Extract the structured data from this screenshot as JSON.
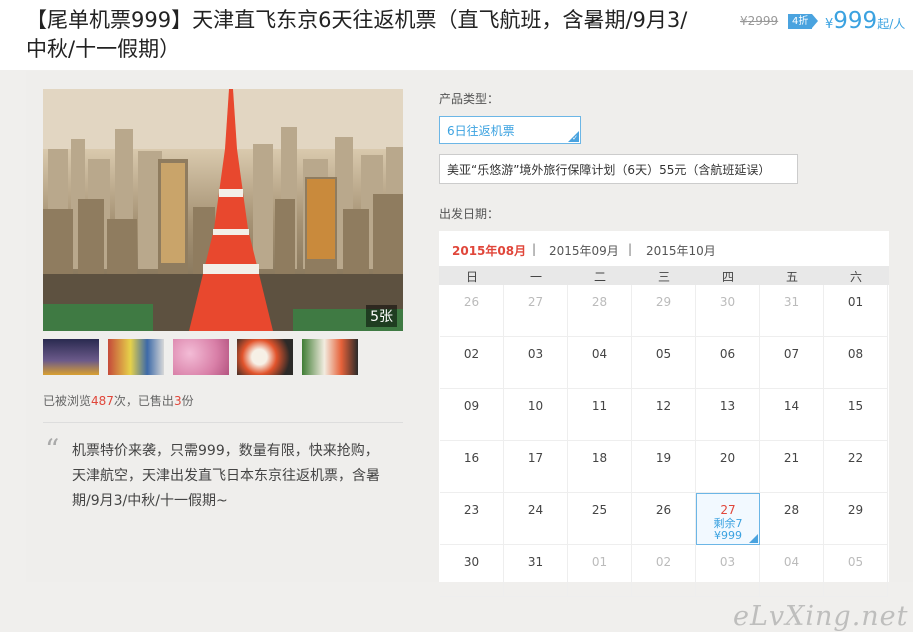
{
  "header": {
    "title": "【尾单机票999】天津直飞东京6天往返机票（直飞航班，含暑期/9月3/中秋/十一假期）",
    "original_price": "¥2999",
    "discount": "4折",
    "price_currency": "¥",
    "price_value": "999",
    "price_unit": "起/人"
  },
  "gallery": {
    "photo_count": "5张",
    "thumbnails": [
      "night-city-thumb",
      "street-thumb",
      "cherry-blossom-thumb",
      "sushi-thumb",
      "sushi-platter-thumb"
    ]
  },
  "stats": {
    "views_prefix": "已被浏览",
    "views": "487",
    "views_suffix": "次，已售出",
    "sold": "3",
    "sold_suffix": "份"
  },
  "description": "机票特价来袭，只需999，数量有限，快来抢购，天津航空，天津出发直飞日本东京往返机票，含暑期/9月3/中秋/十一假期~",
  "product": {
    "type_label": "产品类型：",
    "selected_type": "6日往返机票",
    "insurance_option": "美亚“乐悠游”境外旅行保障计划（6天）55元（含航班延误）",
    "date_label": "出发日期："
  },
  "calendar": {
    "months": [
      "2015年08月",
      "2015年09月",
      "2015年10月"
    ],
    "separator": "|",
    "weekdays": [
      "日",
      "一",
      "二",
      "三",
      "四",
      "五",
      "六"
    ],
    "rows": [
      [
        "26",
        "27",
        "28",
        "29",
        "30",
        "31",
        "01"
      ],
      [
        "02",
        "03",
        "04",
        "05",
        "06",
        "07",
        "08"
      ],
      [
        "09",
        "10",
        "11",
        "12",
        "13",
        "14",
        "15"
      ],
      [
        "16",
        "17",
        "18",
        "19",
        "20",
        "21",
        "22"
      ],
      [
        "23",
        "24",
        "25",
        "26",
        "27",
        "28",
        "29"
      ],
      [
        "30",
        "31",
        "01",
        "02",
        "03",
        "04",
        "05"
      ]
    ],
    "available": {
      "day": "27",
      "remaining": "剩余7",
      "price": "¥999"
    }
  },
  "watermark": "eLvXing.net",
  "colors": {
    "accent_blue": "#3ba2e0",
    "accent_red": "#e0463a"
  }
}
